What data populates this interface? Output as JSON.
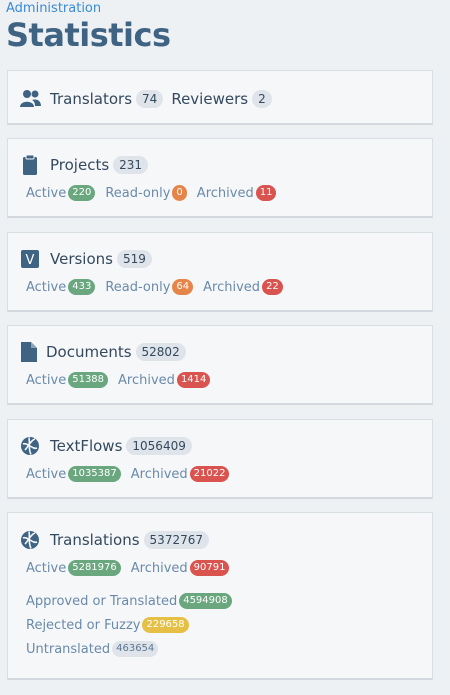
{
  "header": {
    "breadcrumb": "Administration",
    "title": "Statistics"
  },
  "people": {
    "translators_label": "Translators",
    "translators_count": "74",
    "reviewers_label": "Reviewers",
    "reviewers_count": "2"
  },
  "projects": {
    "label": "Projects",
    "count": "231",
    "active_label": "Active",
    "active_count": "220",
    "readonly_label": "Read-only",
    "readonly_count": "0",
    "archived_label": "Archived",
    "archived_count": "11"
  },
  "versions": {
    "icon_letter": "V",
    "label": "Versions",
    "count": "519",
    "active_label": "Active",
    "active_count": "433",
    "readonly_label": "Read-only",
    "readonly_count": "64",
    "archived_label": "Archived",
    "archived_count": "22"
  },
  "documents": {
    "label": "Documents",
    "count": "52802",
    "active_label": "Active",
    "active_count": "51388",
    "archived_label": "Archived",
    "archived_count": "1414"
  },
  "textflows": {
    "label": "TextFlows",
    "count": "1056409",
    "active_label": "Active",
    "active_count": "1035387",
    "archived_label": "Archived",
    "archived_count": "21022"
  },
  "translations": {
    "label": "Translations",
    "count": "5372767",
    "active_label": "Active",
    "active_count": "5281976",
    "archived_label": "Archived",
    "archived_count": "90791",
    "approved_label": "Approved or Translated",
    "approved_count": "4594908",
    "rejected_label": "Rejected or Fuzzy",
    "rejected_count": "229658",
    "untranslated_label": "Untranslated",
    "untranslated_count": "463654"
  },
  "icons": {
    "people": "users-icon",
    "projects": "clipboard-icon",
    "versions": "version-icon",
    "documents": "document-icon",
    "textflows": "globe-icon",
    "translations": "globe-icon"
  },
  "colors": {
    "title": "#3e6383",
    "link": "#3a8bd4",
    "active": "#6aa77f",
    "readonly": "#e6854a",
    "archived": "#d9534f",
    "fuzzy": "#e6c046"
  }
}
